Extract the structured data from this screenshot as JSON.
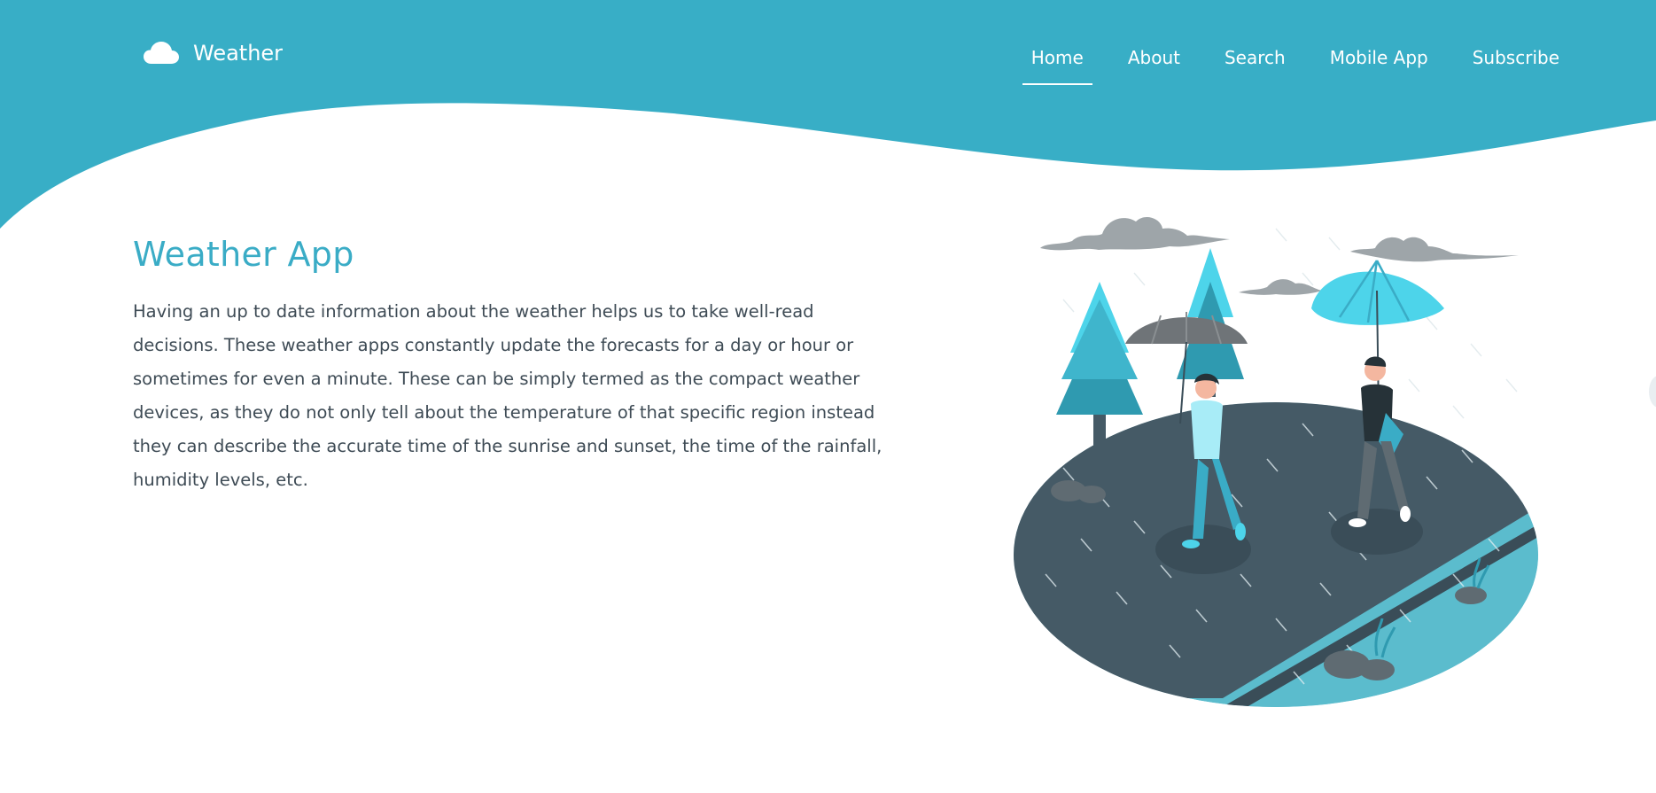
{
  "colors": {
    "header": "#38aec6",
    "title": "#3aacc6",
    "text": "#3e4b55",
    "road": "#455a66",
    "ground": "#5bbccd",
    "tree_light": "#4dd4ea",
    "tree_dark": "#2f9ab0",
    "cloud": "#9ea5a9"
  },
  "brand": {
    "icon": "cloud-icon",
    "name": "Weather"
  },
  "nav": {
    "items": [
      {
        "label": "Home",
        "active": true
      },
      {
        "label": "About",
        "active": false
      },
      {
        "label": "Search",
        "active": false
      },
      {
        "label": "Mobile App",
        "active": false
      },
      {
        "label": "Subscribe",
        "active": false
      }
    ]
  },
  "hero": {
    "title": "Weather App",
    "description": "Having an up to date information about the weather helps us to take well-read decisions. These weather apps constantly update the forecasts for a day or hour or sometimes for even a minute. These can be simply termed as the compact weather devices, as they do not only tell about the temperature of that specific region instead they can describe the accurate time of the sunrise and sunset, the time of the rainfall, humidity levels, etc."
  },
  "illustration": {
    "subject": "people-walking-with-umbrellas-in-rain"
  }
}
